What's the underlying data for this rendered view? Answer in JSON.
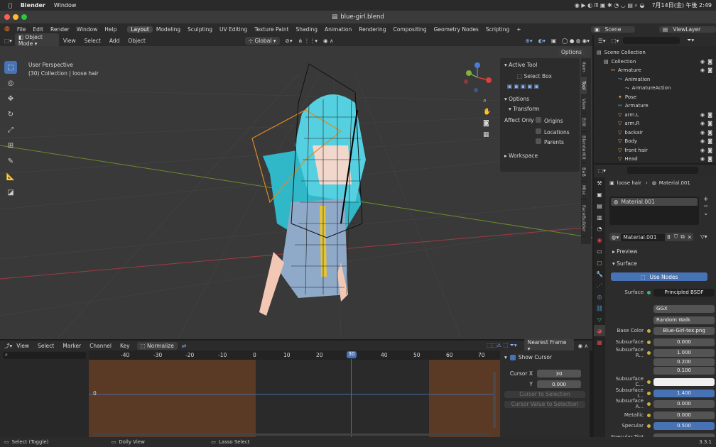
{
  "macos": {
    "app": "Blender",
    "menu": "Window",
    "status_right": "7月14日(金) 午後 2:49"
  },
  "window": {
    "title": "blue-girl.blend"
  },
  "menu": {
    "items": [
      "File",
      "Edit",
      "Render",
      "Window",
      "Help"
    ]
  },
  "workspaces": [
    "Layout",
    "Modeling",
    "Sculpting",
    "UV Editing",
    "Texture Paint",
    "Shading",
    "Animation",
    "Rendering",
    "Compositing",
    "Geometry Nodes",
    "Scripting"
  ],
  "active_workspace": "Layout",
  "scene": "Scene",
  "viewlayer": "ViewLayer",
  "viewport": {
    "mode": "Object Mode",
    "menu": [
      "View",
      "Select",
      "Add",
      "Object"
    ],
    "orientation": "Global",
    "options_label": "Options",
    "overlay_title": "User Perspective",
    "overlay_sub": "(30) Collection | loose hair"
  },
  "npanel": {
    "active_tool": "Active Tool",
    "select_box": "Select Box",
    "options": "Options",
    "transform": "Transform",
    "affect_only": "Affect Only",
    "origins": "Origins",
    "locations": "Locations",
    "parents": "Parents",
    "workspace": "Workspace"
  },
  "ntabs": [
    "Item",
    "Tool",
    "View",
    "Edit",
    "BlenderKit",
    "BaB",
    "Misc",
    "FaceBuilder"
  ],
  "outliner": {
    "rows": [
      {
        "label": "Scene Collection",
        "indent": 0
      },
      {
        "label": "Collection",
        "indent": 1
      },
      {
        "label": "Armature",
        "indent": 2
      },
      {
        "label": "Animation",
        "indent": 3
      },
      {
        "label": "ArmatureAction",
        "indent": 4
      },
      {
        "label": "Pose",
        "indent": 3
      },
      {
        "label": "Armature",
        "indent": 3
      },
      {
        "label": "arm.L",
        "indent": 3
      },
      {
        "label": "arm.R",
        "indent": 3
      },
      {
        "label": "backair",
        "indent": 3
      },
      {
        "label": "Body",
        "indent": 3
      },
      {
        "label": "front hair",
        "indent": 3
      },
      {
        "label": "Head",
        "indent": 3
      }
    ]
  },
  "properties": {
    "breadcrumb_object": "loose hair",
    "breadcrumb_material": "Material.001",
    "slot": "Material.001",
    "material_name": "Material.001",
    "users": "8",
    "preview": "Preview",
    "surface_panel": "Surface",
    "use_nodes": "Use Nodes",
    "rows": [
      {
        "label": "Surface",
        "value": "Principled BSDF"
      },
      {
        "label": "",
        "value": "GGX"
      },
      {
        "label": "",
        "value": "Random Walk"
      },
      {
        "label": "Base Color",
        "value": "Blue-Girl-tex.png"
      },
      {
        "label": "Subsurface",
        "value": "0.000"
      },
      {
        "label": "Subsurface R...",
        "value": "1.000"
      },
      {
        "label": "",
        "value": "0.200"
      },
      {
        "label": "",
        "value": "0.100"
      },
      {
        "label": "Subsurface C...",
        "value": ""
      },
      {
        "label": "Subsurface I...",
        "value": "1.400"
      },
      {
        "label": "Subsurface A...",
        "value": "0.000"
      },
      {
        "label": "Metallic",
        "value": "0.000"
      },
      {
        "label": "Specular",
        "value": "0.500"
      },
      {
        "label": "Specular Tint",
        "value": ""
      }
    ]
  },
  "timeline": {
    "menu": [
      "View",
      "Select",
      "Marker",
      "Channel",
      "Key"
    ],
    "normalize": "Normalize",
    "interp": "Nearest Frame",
    "ticks": [
      "-40",
      "-30",
      "-20",
      "-10",
      "0",
      "10",
      "20",
      "30",
      "40",
      "50",
      "60",
      "70"
    ],
    "current_frame": "30",
    "zero_label": "0"
  },
  "tlpanel": {
    "show_cursor": "Show Cursor",
    "cursor_x_label": "Cursor X",
    "cursor_x": "30",
    "y_label": "Y",
    "y": "0.000",
    "btn1": "Cursor to Selection",
    "btn2": "Cursor Value to Selection"
  },
  "statusbar": {
    "select": "Select (Toggle)",
    "dolly": "Dolly View",
    "lasso": "Lasso Select",
    "version": "3.3.1"
  }
}
